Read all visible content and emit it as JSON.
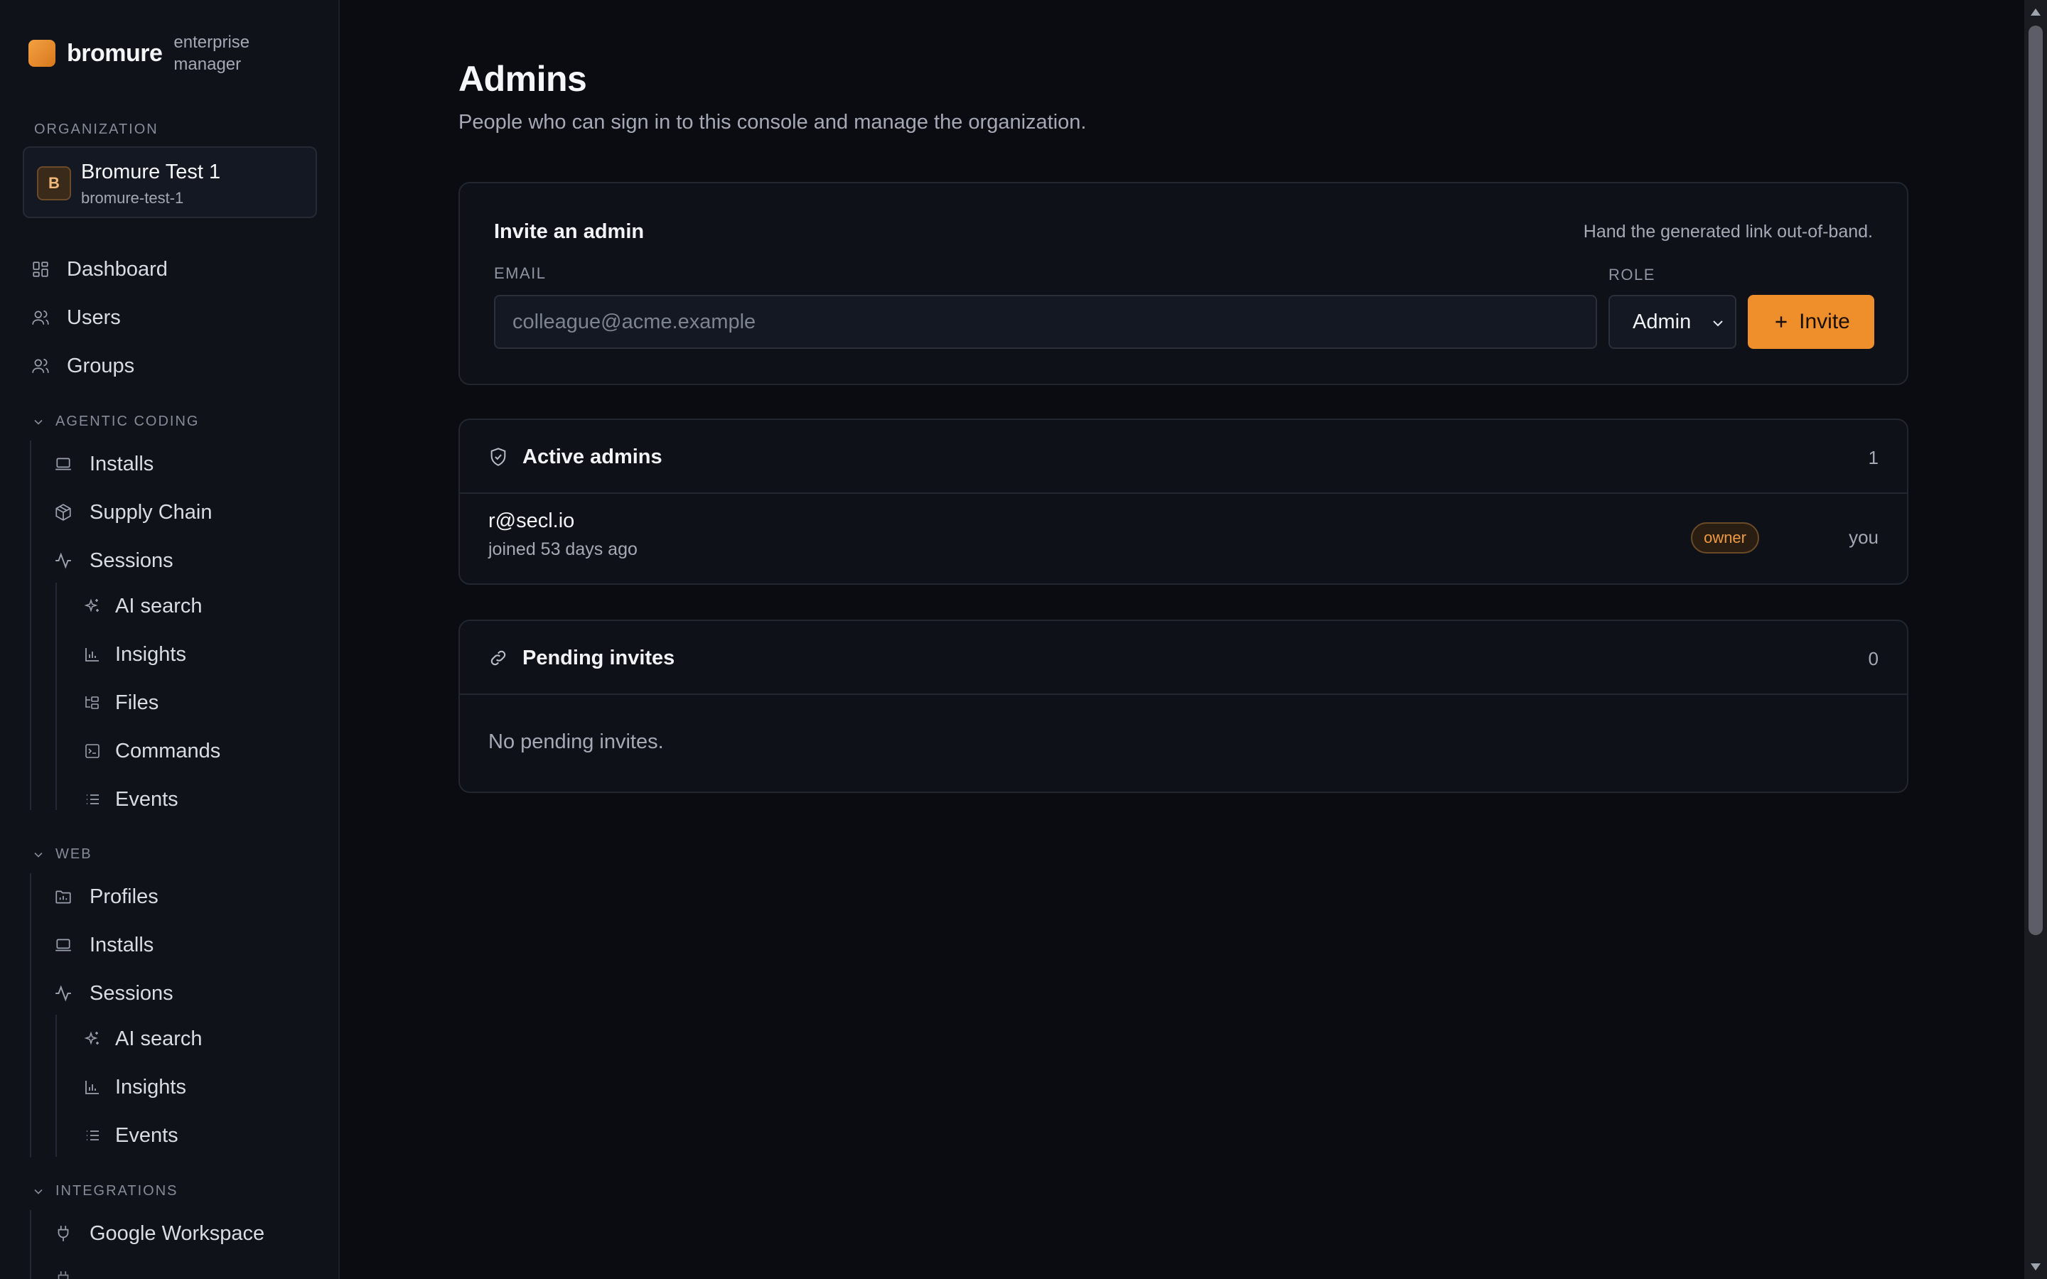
{
  "brand": {
    "name": "bromure",
    "tagline": "enterprise manager"
  },
  "organization": {
    "section_label": "ORGANIZATION",
    "avatar_letter": "B",
    "name": "Bromure Test 1",
    "slug": "bromure-test-1"
  },
  "nav": {
    "main": [
      {
        "label": "Dashboard",
        "icon": "dashboard-icon"
      },
      {
        "label": "Users",
        "icon": "users-icon"
      },
      {
        "label": "Groups",
        "icon": "groups-icon"
      }
    ],
    "agentic": {
      "header": "AGENTIC CODING",
      "items": [
        {
          "label": "Installs",
          "icon": "laptop-icon"
        },
        {
          "label": "Supply Chain",
          "icon": "package-icon"
        },
        {
          "label": "Sessions",
          "icon": "activity-icon"
        }
      ],
      "session_items": [
        {
          "label": "AI search",
          "icon": "sparkles-icon"
        },
        {
          "label": "Insights",
          "icon": "bar-chart-icon"
        },
        {
          "label": "Files",
          "icon": "folder-tree-icon"
        },
        {
          "label": "Commands",
          "icon": "terminal-icon"
        },
        {
          "label": "Events",
          "icon": "list-icon"
        }
      ]
    },
    "web": {
      "header": "WEB",
      "items": [
        {
          "label": "Profiles",
          "icon": "folder-profile-icon"
        },
        {
          "label": "Installs",
          "icon": "laptop-icon"
        },
        {
          "label": "Sessions",
          "icon": "activity-icon"
        }
      ],
      "session_items": [
        {
          "label": "AI search",
          "icon": "sparkles-icon"
        },
        {
          "label": "Insights",
          "icon": "bar-chart-icon"
        },
        {
          "label": "Events",
          "icon": "list-icon"
        }
      ]
    },
    "integrations": {
      "header": "INTEGRATIONS",
      "items": [
        {
          "label": "Google Workspace",
          "icon": "plug-icon"
        }
      ]
    }
  },
  "page": {
    "title": "Admins",
    "subtitle": "People who can sign in to this console and manage the organization."
  },
  "invite": {
    "title": "Invite an admin",
    "hint": "Hand the generated link out-of-band.",
    "email_label": "EMAIL",
    "email_placeholder": "colleague@acme.example",
    "email_value": "",
    "role_label": "ROLE",
    "role_value": "Admin",
    "button_label": "Invite"
  },
  "active_admins": {
    "title": "Active admins",
    "count": "1",
    "rows": [
      {
        "email": "r@secl.io",
        "joined": "joined 53 days ago",
        "badge": "owner",
        "note": "you"
      }
    ]
  },
  "pending_invites": {
    "title": "Pending invites",
    "count": "0",
    "empty_text": "No pending invites."
  },
  "colors": {
    "accent": "#ee8f2b",
    "background": "#0a0c12",
    "sidebar": "#0f1219",
    "card": "#0e1118"
  }
}
